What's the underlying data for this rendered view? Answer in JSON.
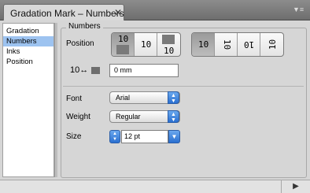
{
  "window": {
    "tab_title": "Gradation Mark – Numbers",
    "close_glyph": "✕",
    "menu_glyph": "▼≡"
  },
  "sidebar": {
    "items": [
      {
        "label": "Gradation"
      },
      {
        "label": "Numbers"
      },
      {
        "label": "Inks"
      },
      {
        "label": "Position"
      }
    ],
    "selected": "Numbers"
  },
  "numbers": {
    "group_title": "Numbers",
    "position_label": "Position",
    "position_glyph": "10",
    "offset_icon": "10↔",
    "offset_value": "0 mm"
  },
  "font": {
    "label": "Font",
    "value": "Arial"
  },
  "weight": {
    "label": "Weight",
    "value": "Regular"
  },
  "size": {
    "label": "Size",
    "value": "12 pt"
  },
  "status": {
    "play_glyph": "▶"
  },
  "colors": {
    "selection": "#9dc3f0",
    "accent": "#2a6fd0"
  }
}
